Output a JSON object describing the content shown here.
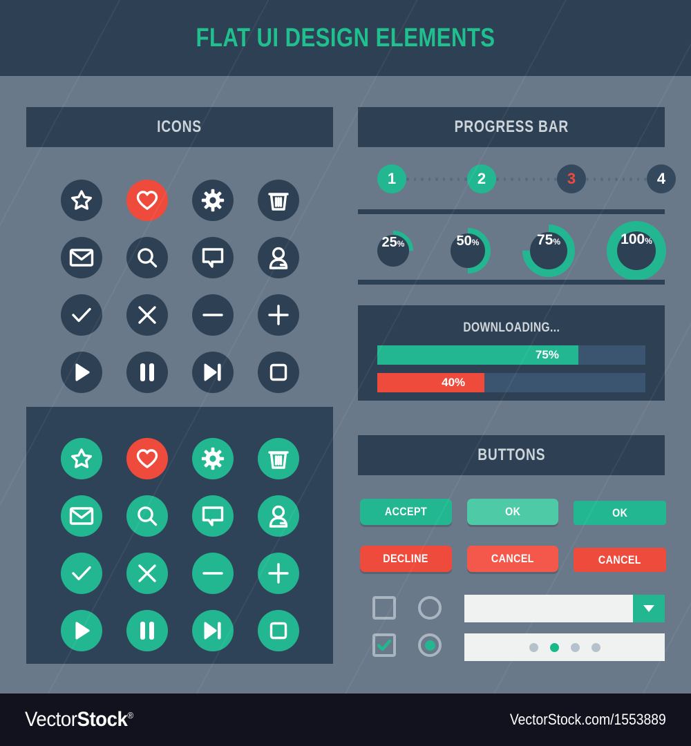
{
  "header": {
    "title": "FLAT UI DESIGN ELEMENTS"
  },
  "footer": {
    "brand": "VectorStock",
    "brand_suffix": "Stock",
    "brand_prefix": "Vector",
    "reg": "®",
    "url": "VectorStock.com/1553889"
  },
  "colors": {
    "page_bg": "#69798a",
    "dark_navy": "#2e4054",
    "panel_navy": "#2e4258",
    "teal": "#22b791",
    "teal_light": "#4ecaa6",
    "red": "#ee4b3c",
    "red_light": "#f4584a",
    "track": "#3b5470",
    "header_text": "#1fc08e",
    "title_text": "#cdd4da",
    "footer_bg": "#12121f",
    "control_border": "#a9b5bf",
    "field_bg": "#f0f2f2"
  },
  "sections": {
    "icons": {
      "title": "ICONS"
    },
    "progress": {
      "title": "PROGRESS BAR"
    },
    "buttons": {
      "title": "BUTTONS"
    }
  },
  "icons": {
    "rows": [
      [
        "star-icon",
        "heart-icon",
        "gear-icon",
        "trash-icon"
      ],
      [
        "envelope-icon",
        "search-icon",
        "comment-icon",
        "user-icon"
      ],
      [
        "check-icon",
        "close-icon",
        "minus-icon",
        "plus-icon"
      ],
      [
        "play-icon",
        "pause-icon",
        "next-icon",
        "stop-icon"
      ]
    ],
    "accent_cell": "heart-icon"
  },
  "steps": [
    {
      "label": "1",
      "state": "complete"
    },
    {
      "label": "2",
      "state": "complete"
    },
    {
      "label": "3",
      "state": "active"
    },
    {
      "label": "4",
      "state": "pending"
    }
  ],
  "donuts": [
    {
      "label": "25",
      "pct_symbol": "%",
      "value": 25
    },
    {
      "label": "50",
      "pct_symbol": "%",
      "value": 50
    },
    {
      "label": "75",
      "pct_symbol": "%",
      "value": 75
    },
    {
      "label": "100",
      "pct_symbol": "%",
      "value": 100
    }
  ],
  "download": {
    "title": "DOWNLOADING...",
    "bars": [
      {
        "label": "75%",
        "value": 75,
        "color": "teal"
      },
      {
        "label": "40%",
        "value": 40,
        "color": "red"
      }
    ]
  },
  "buttons": [
    {
      "label": "ACCEPT",
      "style": "teal",
      "shape": "r-lg",
      "shadow": true
    },
    {
      "label": "OK",
      "style": "teal-light",
      "shape": "r-lg",
      "shadow": true
    },
    {
      "label": "OK",
      "style": "teal",
      "shape": "r-sm",
      "shadow": false
    },
    {
      "label": "DECLINE",
      "style": "red",
      "shape": "r-lg",
      "shadow": true
    },
    {
      "label": "CANCEL",
      "style": "red-light",
      "shape": "r-lg",
      "shadow": true
    },
    {
      "label": "CANCEL",
      "style": "red",
      "shape": "r-sm",
      "shadow": false
    }
  ],
  "controls": {
    "checkbox_unchecked": {
      "checked": false
    },
    "checkbox_checked": {
      "checked": true
    },
    "radio_unselected": {
      "selected": false
    },
    "radio_selected": {
      "selected": true
    },
    "dropdown": {
      "value": "",
      "placeholder": ""
    },
    "pagination": {
      "count": 4,
      "active_index": 1
    }
  }
}
